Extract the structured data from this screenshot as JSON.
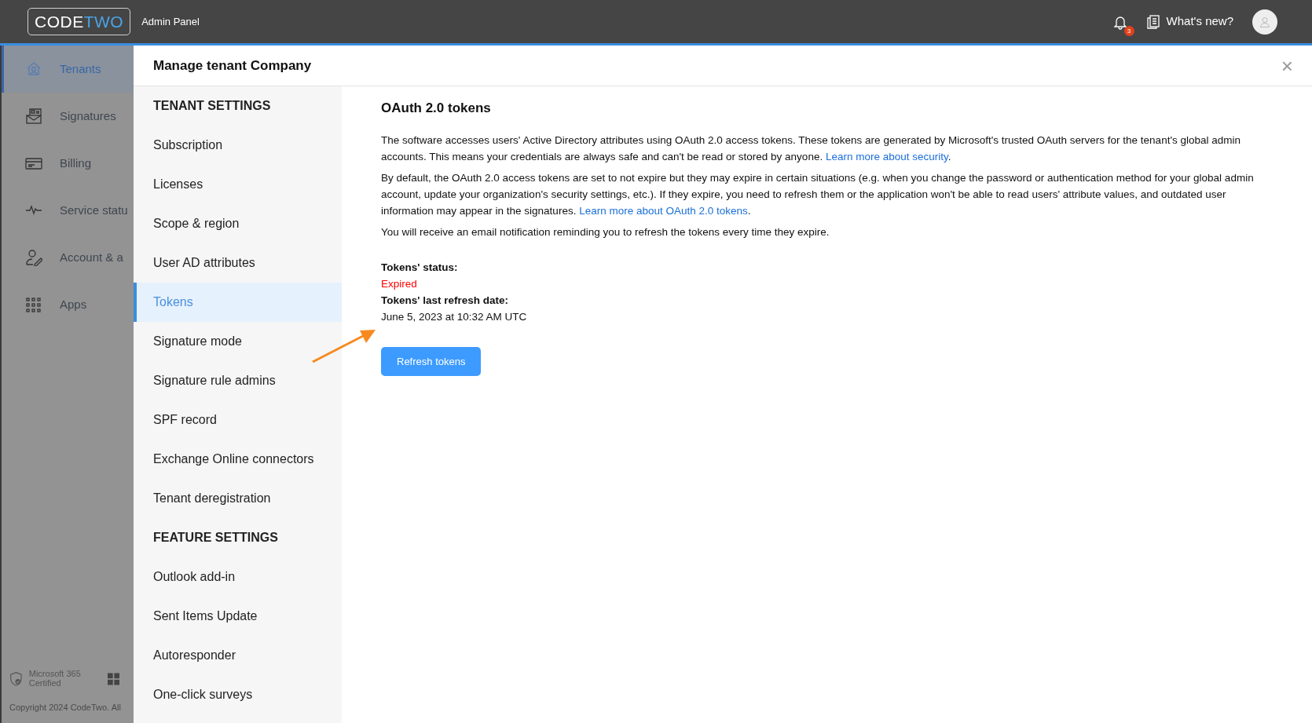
{
  "header": {
    "logo": {
      "first": "CODE",
      "second": "TWO"
    },
    "app_title": "Admin Panel",
    "notifications": {
      "count": "3"
    },
    "whats_new": "What's new?"
  },
  "sidebar": {
    "items": [
      {
        "label": "Tenants",
        "kind": "house",
        "selected": true
      },
      {
        "label": "Signatures",
        "kind": "mail",
        "selected": false
      },
      {
        "label": "Billing",
        "kind": "card",
        "selected": false
      },
      {
        "label": "Service statu",
        "kind": "pulse",
        "selected": false
      },
      {
        "label": "Account & a",
        "kind": "user",
        "selected": false
      },
      {
        "label": "Apps",
        "kind": "grid",
        "selected": false
      }
    ],
    "badge": "Microsoft 365 Certified",
    "copyright": "Copyright 2024 CodeTwo. All"
  },
  "panel": {
    "title": "Manage tenant Company",
    "close": "×",
    "menu": [
      {
        "kind": "heading",
        "label": "TENANT SETTINGS"
      },
      {
        "kind": "item",
        "label": "Subscription",
        "selected": false
      },
      {
        "kind": "item",
        "label": "Licenses",
        "selected": false
      },
      {
        "kind": "item",
        "label": "Scope & region",
        "selected": false
      },
      {
        "kind": "item",
        "label": "User AD attributes",
        "selected": false
      },
      {
        "kind": "item",
        "label": "Tokens",
        "selected": true
      },
      {
        "kind": "item",
        "label": "Signature mode",
        "selected": false
      },
      {
        "kind": "item",
        "label": "Signature rule admins",
        "selected": false
      },
      {
        "kind": "item",
        "label": "SPF record",
        "selected": false
      },
      {
        "kind": "item",
        "label": "Exchange Online connectors",
        "selected": false
      },
      {
        "kind": "item",
        "label": "Tenant deregistration",
        "selected": false
      },
      {
        "kind": "heading",
        "label": "FEATURE SETTINGS"
      },
      {
        "kind": "item",
        "label": "Outlook add-in",
        "selected": false
      },
      {
        "kind": "item",
        "label": "Sent Items Update",
        "selected": false
      },
      {
        "kind": "item",
        "label": "Autoresponder",
        "selected": false
      },
      {
        "kind": "item",
        "label": "One-click surveys",
        "selected": false
      }
    ],
    "content": {
      "title": "OAuth 2.0 tokens",
      "paragraphs": [
        {
          "text": "The software accesses users' Active Directory attributes using OAuth 2.0 access tokens. These tokens are generated by Microsoft's trusted OAuth servers for the tenant's global admin accounts. This means your credentials are always safe and can't be read or stored by anyone.",
          "link": "Learn more about security",
          "after": "."
        },
        {
          "text": "By default, the OAuth 2.0 access tokens are set to not expire but they may expire in certain situations (e.g. when you change the password or authentication method for your global admin account, update your organization's security settings, etc.). If they expire, you need to refresh them or the application won't be able to read users' attribute values, and outdated user information may appear in the signatures.",
          "link": "Learn more about OAuth 2.0 tokens",
          "after": "."
        },
        {
          "text": "You will receive an email notification reminding you to refresh the tokens every time they expire."
        }
      ],
      "fields": [
        {
          "label": "Tokens' status:",
          "value": "Expired",
          "kind": "status",
          "color": "#ff0000"
        },
        {
          "label": "Tokens' last refresh date:",
          "value": "June 5, 2023 at 10:32 AM UTC",
          "kind": "plain"
        }
      ],
      "button": "Refresh tokens"
    }
  }
}
